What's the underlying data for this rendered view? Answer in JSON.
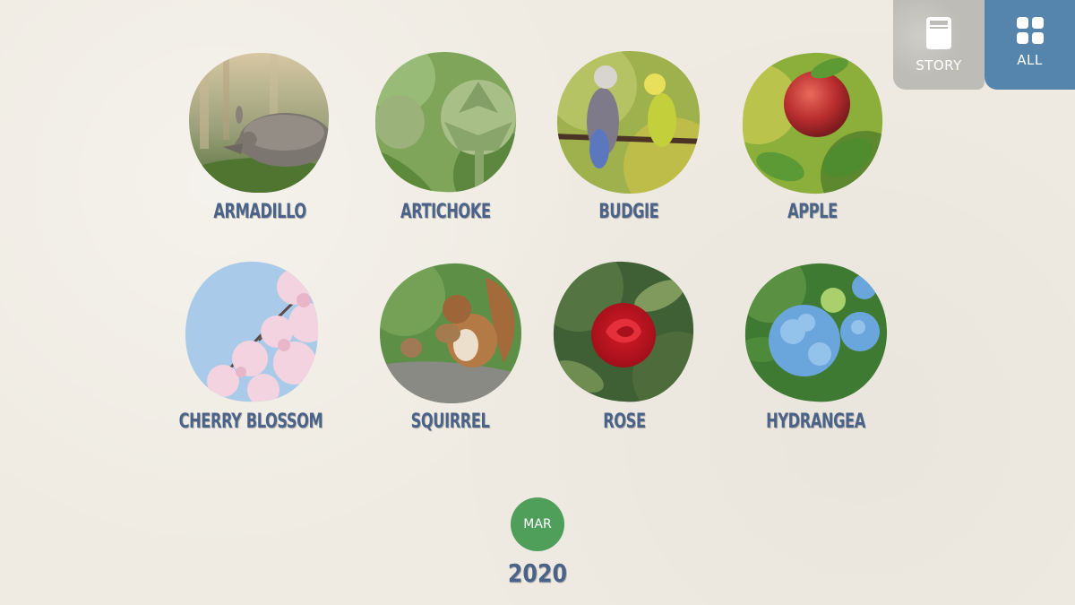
{
  "modes": {
    "story": {
      "label": "STORY",
      "icon": "book-icon"
    },
    "all": {
      "label": "ALL",
      "icon": "grid-icon"
    }
  },
  "items": [
    {
      "label": "ARMADILLO",
      "icon": "armadillo-photo"
    },
    {
      "label": "ARTICHOKE",
      "icon": "artichoke-photo"
    },
    {
      "label": "BUDGIE",
      "icon": "budgie-photo"
    },
    {
      "label": "APPLE",
      "icon": "apple-photo"
    },
    {
      "label": "CHERRY BLOSSOM",
      "icon": "cherry-blossom-photo"
    },
    {
      "label": "SQUIRREL",
      "icon": "squirrel-photo"
    },
    {
      "label": "ROSE",
      "icon": "rose-photo"
    },
    {
      "label": "HYDRANGEA",
      "icon": "hydrangea-photo"
    }
  ],
  "timeline": {
    "month": "MAR",
    "year": "2020"
  },
  "colors": {
    "background": "#efebe2",
    "label_text": "#4b6388",
    "story_button": "#bdbcb7",
    "all_button": "#5584ad",
    "month_badge": "#4f9f5b"
  }
}
